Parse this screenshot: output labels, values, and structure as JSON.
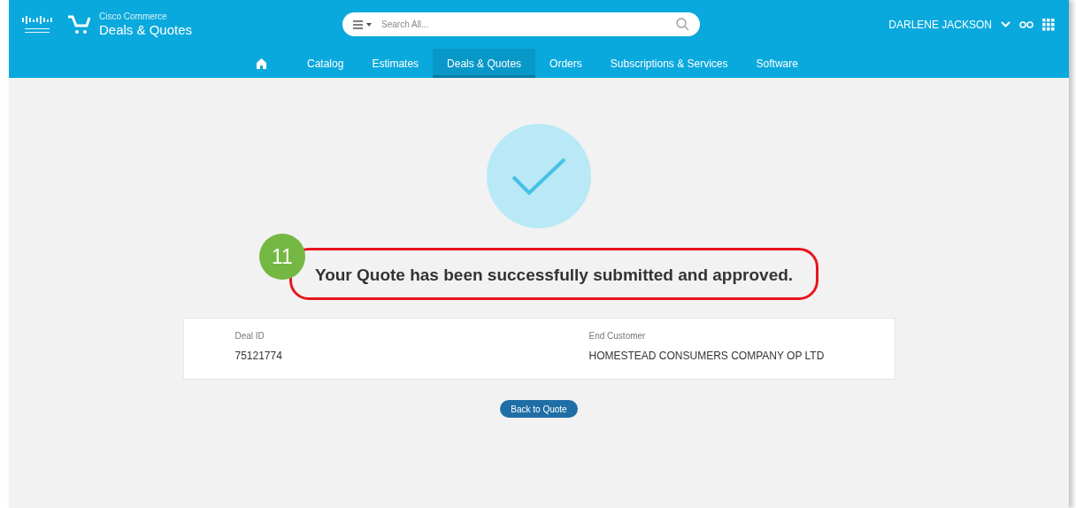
{
  "header": {
    "brand_small": "Cisco Commerce",
    "brand_title": "Deals & Quotes",
    "search": {
      "placeholder": "Search All..."
    },
    "user": "DARLENE JACKSON"
  },
  "nav": [
    {
      "kind": "home",
      "selected": false
    },
    {
      "label": "Catalog",
      "kind": "link",
      "selected": false
    },
    {
      "label": "Estimates",
      "kind": "link",
      "selected": false
    },
    {
      "label": "Deals & Quotes",
      "kind": "link",
      "selected": true
    },
    {
      "label": "Orders",
      "kind": "link",
      "selected": false
    },
    {
      "label": "Subscriptions & Services",
      "kind": "link",
      "selected": false
    },
    {
      "label": "Software",
      "kind": "link",
      "selected": false
    }
  ],
  "confirmation": {
    "message": "Your Quote has been successfully submitted and approved.",
    "step_badge": "11",
    "highlighted": true
  },
  "details": [
    {
      "label": "Deal ID",
      "value": "75121774"
    },
    {
      "label": "End Customer",
      "value": "HOMESTEAD CONSUMERS COMPANY OP LTD"
    }
  ],
  "button": "Back to Quote"
}
